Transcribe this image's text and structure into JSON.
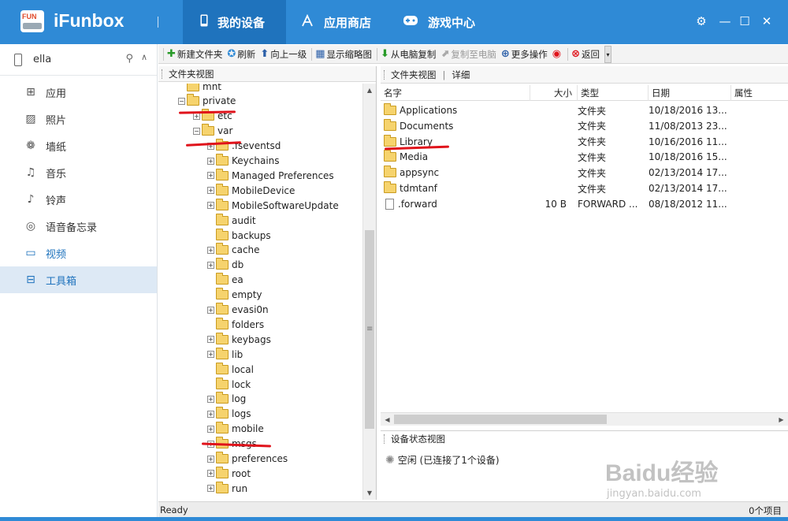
{
  "app": {
    "name": "iFunbox",
    "logo_text": "FUN"
  },
  "nav_tabs": [
    {
      "label": "我的设备",
      "icon": "phone-icon",
      "active": true
    },
    {
      "label": "应用商店",
      "icon": "app-store-icon",
      "active": false
    },
    {
      "label": "游戏中心",
      "icon": "gamepad-icon",
      "active": false
    }
  ],
  "device": {
    "name": "ella"
  },
  "sidebar": {
    "items": [
      {
        "label": "应用",
        "icon": "apps-icon"
      },
      {
        "label": "照片",
        "icon": "photos-icon"
      },
      {
        "label": "墙纸",
        "icon": "wallpaper-icon"
      },
      {
        "label": "音乐",
        "icon": "music-icon"
      },
      {
        "label": "铃声",
        "icon": "ringtone-icon"
      },
      {
        "label": "语音备忘录",
        "icon": "voice-memo-icon"
      },
      {
        "label": "视频",
        "icon": "video-icon"
      },
      {
        "label": "工具箱",
        "icon": "toolbox-icon",
        "selected": true
      }
    ]
  },
  "toolbar": {
    "new_folder": "新建文件夹",
    "refresh": "刷新",
    "up": "向上一级",
    "thumbnails": "显示缩略图",
    "copy_from_pc": "从电脑复制",
    "copy_to_pc": "复制至电脑",
    "more": "更多操作",
    "back": "返回"
  },
  "tree": {
    "header": "文件夹视图",
    "items": [
      {
        "label": "mnt",
        "level": 1,
        "expander": ""
      },
      {
        "label": "private",
        "level": 1,
        "expander": "−"
      },
      {
        "label": "etc",
        "level": 2,
        "expander": "+"
      },
      {
        "label": "var",
        "level": 2,
        "expander": "−"
      },
      {
        "label": ".fseventsd",
        "level": 3,
        "expander": "+"
      },
      {
        "label": "Keychains",
        "level": 3,
        "expander": "+"
      },
      {
        "label": "Managed Preferences",
        "level": 3,
        "expander": "+"
      },
      {
        "label": "MobileDevice",
        "level": 3,
        "expander": "+"
      },
      {
        "label": "MobileSoftwareUpdate",
        "level": 3,
        "expander": "+"
      },
      {
        "label": "audit",
        "level": 3,
        "expander": ""
      },
      {
        "label": "backups",
        "level": 3,
        "expander": ""
      },
      {
        "label": "cache",
        "level": 3,
        "expander": "+"
      },
      {
        "label": "db",
        "level": 3,
        "expander": "+"
      },
      {
        "label": "ea",
        "level": 3,
        "expander": ""
      },
      {
        "label": "empty",
        "level": 3,
        "expander": ""
      },
      {
        "label": "evasi0n",
        "level": 3,
        "expander": "+"
      },
      {
        "label": "folders",
        "level": 3,
        "expander": ""
      },
      {
        "label": "keybags",
        "level": 3,
        "expander": "+"
      },
      {
        "label": "lib",
        "level": 3,
        "expander": "+"
      },
      {
        "label": "local",
        "level": 3,
        "expander": ""
      },
      {
        "label": "lock",
        "level": 3,
        "expander": ""
      },
      {
        "label": "log",
        "level": 3,
        "expander": "+"
      },
      {
        "label": "logs",
        "level": 3,
        "expander": "+"
      },
      {
        "label": "mobile",
        "level": 3,
        "expander": "+"
      },
      {
        "label": "msgs",
        "level": 3,
        "expander": "+"
      },
      {
        "label": "preferences",
        "level": 3,
        "expander": "+"
      },
      {
        "label": "root",
        "level": 3,
        "expander": "+"
      },
      {
        "label": "run",
        "level": 3,
        "expander": "+"
      }
    ]
  },
  "list": {
    "header_view": "文件夹视图",
    "header_sep": "|",
    "header_detail": "详细",
    "columns": {
      "name": "名字",
      "size": "大小",
      "type": "类型",
      "date": "日期",
      "attr": "属性"
    },
    "rows": [
      {
        "name": "Applications",
        "size": "",
        "type": "文件夹",
        "date": "10/18/2016  13...",
        "kind": "folder"
      },
      {
        "name": "Documents",
        "size": "",
        "type": "文件夹",
        "date": "11/08/2013  23...",
        "kind": "folder"
      },
      {
        "name": "Library",
        "size": "",
        "type": "文件夹",
        "date": "10/16/2016  11...",
        "kind": "folder"
      },
      {
        "name": "Media",
        "size": "",
        "type": "文件夹",
        "date": "10/18/2016  15...",
        "kind": "folder"
      },
      {
        "name": "appsync",
        "size": "",
        "type": "文件夹",
        "date": "02/13/2014  17...",
        "kind": "folder"
      },
      {
        "name": "tdmtanf",
        "size": "",
        "type": "文件夹",
        "date": "02/13/2014  17...",
        "kind": "folder"
      },
      {
        "name": ".forward",
        "size": "10 B",
        "type": "FORWARD ...",
        "date": "08/18/2012  11...",
        "kind": "file"
      }
    ]
  },
  "status_pane": {
    "header": "设备状态视图",
    "text": "空闲 (已连接了1个设备)"
  },
  "statusbar": {
    "left": "Ready",
    "right": "0个项目"
  },
  "watermark": {
    "line1": "Baidu经验",
    "line2": "jingyan.baidu.com"
  },
  "colors": {
    "accent": "#2f8ad6",
    "active_tab": "#1f73bd",
    "annotation": "#e0131b",
    "folder": "#f6d36d"
  }
}
